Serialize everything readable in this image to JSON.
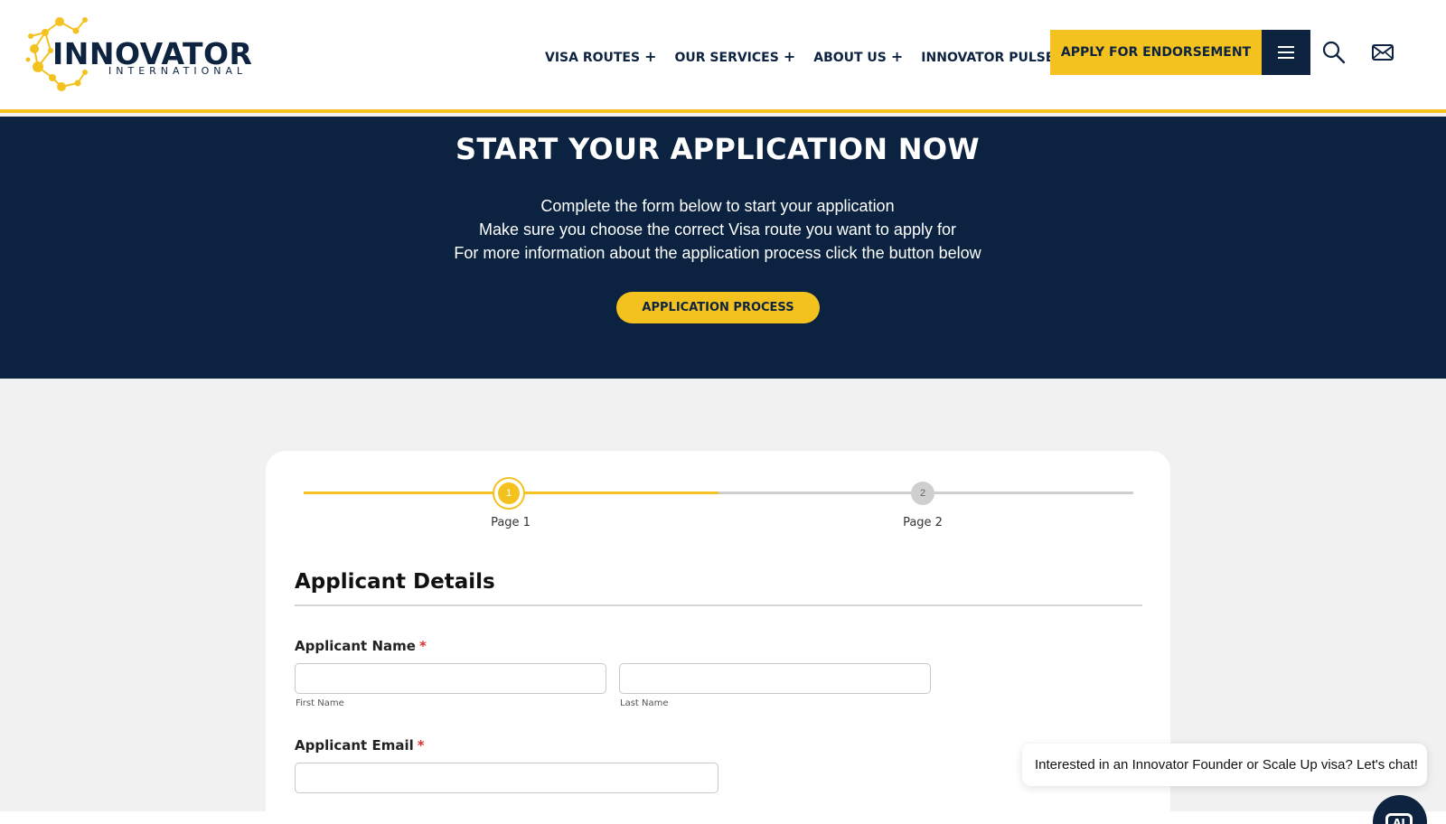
{
  "brand": {
    "name": "INNOVATOR",
    "subtitle": "INTERNATIONAL",
    "accent_color": "#f4c21f",
    "navy_color": "#0b2340"
  },
  "nav": {
    "items": [
      {
        "label": "VISA ROUTES",
        "icon": "plus-icon"
      },
      {
        "label": "OUR SERVICES",
        "icon": "plus-icon"
      },
      {
        "label": "ABOUT US",
        "icon": "plus-icon"
      },
      {
        "label": "INNOVATOR PULSE",
        "icon": "plus-icon"
      }
    ],
    "plus_glyph": "+",
    "apply_label": "APPLY FOR ENDORSEMENT",
    "menu_icon": "hamburger-menu-icon",
    "search_icon": "search-icon",
    "mail_icon": "mail-icon"
  },
  "hero": {
    "title": "START YOUR APPLICATION NOW",
    "lines": [
      "Complete the form below to start your application",
      "Make sure you choose the correct Visa route you want to apply for",
      "For more information about the application process click the button below"
    ],
    "button_label": "APPLICATION PROCESS"
  },
  "form": {
    "steps": [
      {
        "number": "1",
        "label": "Page 1",
        "state": "active"
      },
      {
        "number": "2",
        "label": "Page 2",
        "state": "inactive"
      }
    ],
    "progress_fraction": 0.5,
    "section_title": "Applicant Details",
    "required_mark": "*",
    "name_field": {
      "label": "Applicant Name",
      "first_sublabel": "First Name",
      "last_sublabel": "Last Name",
      "first_value": "",
      "last_value": ""
    },
    "email_field": {
      "label": "Applicant Email",
      "value": ""
    }
  },
  "chat": {
    "message": "Interested in an Innovator Founder or Scale Up visa? Let's chat!",
    "launcher_icon": "chat-icon",
    "launcher_text": "AI"
  }
}
